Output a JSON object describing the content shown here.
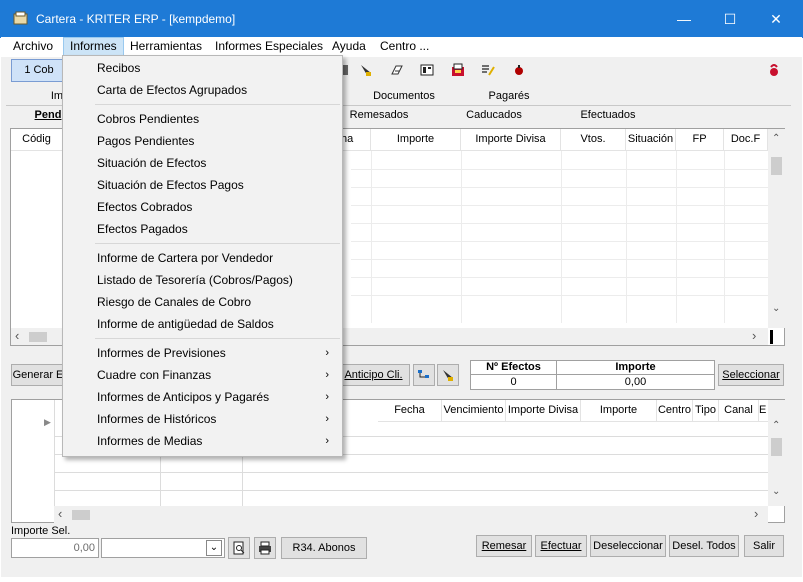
{
  "window": {
    "title": "Cartera - KRITER ERP - [kempdemo]",
    "minimize_glyph": "—",
    "maximize_glyph": "☐",
    "close_glyph": "✕"
  },
  "menubar": {
    "items": [
      "Archivo",
      "Informes",
      "Herramientas",
      "Informes Especiales",
      "Ayuda",
      "Centro ..."
    ]
  },
  "toolbar": {
    "first_button": "1 Cob",
    "icons": [
      "tool-icon-1",
      "tool-icon-2",
      "tool-icon-3",
      "tool-icon-4",
      "tool-icon-5",
      "tool-icon-6",
      "tool-icon-7",
      "help-icon"
    ]
  },
  "tabs_row1": [
    "Im",
    "Documentos",
    "Pagarés"
  ],
  "tabs_row2": [
    "Pend",
    "Remesados",
    "Caducados",
    "Efectuados"
  ],
  "top_grid": {
    "headers": [
      "Códig",
      "ha",
      "Importe",
      "Importe Divisa",
      "Vtos.",
      "Situación",
      "FP",
      "Doc.F"
    ]
  },
  "middle": {
    "generar_label": "Generar E",
    "anticipo_label": "Anticipo Cli.",
    "efectos_header": "Nº Efectos",
    "efectos_value": "0",
    "importe_header": "Importe",
    "importe_value": "0,00",
    "seleccionar_label": "Seleccionar"
  },
  "bottom_grid": {
    "headers": [
      "Fecha",
      "Vencimiento",
      "Importe Divisa",
      "Importe",
      "Centro",
      "Tipo",
      "Canal",
      "E"
    ]
  },
  "footer": {
    "importe_sel_label": "Importe Sel.",
    "importe_sel_value": "0,00",
    "r34_label": "R34. Abonos",
    "buttons": [
      "Remesar",
      "Efectuar",
      "Deseleccionar",
      "Desel. Todos",
      "Salir"
    ]
  },
  "dropdown": {
    "groups": [
      [
        "Recibos",
        "Carta de Efectos Agrupados"
      ],
      [
        "Cobros Pendientes",
        "Pagos Pendientes",
        "Situación de Efectos",
        "Situación de Efectos Pagos",
        "Efectos Cobrados",
        "Efectos Pagados"
      ],
      [
        "Informe de Cartera por Vendedor",
        "Listado de Tesorería (Cobros/Pagos)",
        "Riesgo de Canales de Cobro",
        "Informe de antigüedad de Saldos"
      ],
      [
        "Informes de Previsiones",
        "Cuadre con Finanzas",
        "Informes de Anticipos y Pagarés",
        "Informes de Históricos",
        "Informes de Medias"
      ]
    ],
    "submenu_arrow": "›"
  },
  "colors": {
    "titlebar": "#1e7ad6",
    "menu_highlight": "#cce4f7",
    "face": "#f0f0f0"
  }
}
